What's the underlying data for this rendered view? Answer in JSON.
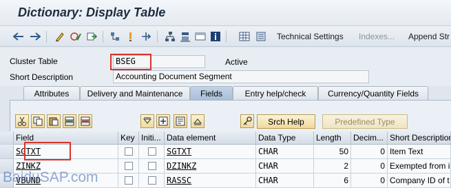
{
  "window": {
    "title": "Dictionary: Display Table"
  },
  "toolbar": {
    "technical_settings": "Technical Settings",
    "indexes": "Indexes...",
    "append_structure": "Append Str"
  },
  "header": {
    "table_type_label": "Cluster Table",
    "table_name": "BSEG",
    "status": "Active",
    "short_desc_label": "Short Description",
    "short_desc_value": "Accounting Document Segment"
  },
  "tabs": [
    "Attributes",
    "Delivery and Maintenance",
    "Fields",
    "Entry help/check",
    "Currency/Quantity Fields"
  ],
  "active_tab": "Fields",
  "grid_toolbar": {
    "srch_help": "Srch Help",
    "predefined_type": "Predefined Type"
  },
  "grid": {
    "columns": [
      "Field",
      "Key",
      "Initi...",
      "Data element",
      "Data Type",
      "Length",
      "Decim...",
      "Short Description"
    ],
    "rows": [
      {
        "field": "SGTXT",
        "key": false,
        "initial": false,
        "data_element": "SGTXT",
        "data_type": "CHAR",
        "length": "50",
        "decimals": "0",
        "short_description": "Item Text"
      },
      {
        "field": "ZINKZ",
        "key": false,
        "initial": false,
        "data_element": "DZINKZ",
        "data_type": "CHAR",
        "length": "2",
        "decimals": "0",
        "short_description": "Exempted from i"
      },
      {
        "field": "VBUND",
        "key": false,
        "initial": false,
        "data_element": "RASSC",
        "data_type": "CHAR",
        "length": "6",
        "decimals": "0",
        "short_description": "Company ID of t"
      }
    ]
  },
  "watermark": "BaiduSAP.com",
  "colors": {
    "highlight": "#d6342b",
    "active_tab": "#a8bfd9",
    "button_fill": "#f0d999"
  }
}
